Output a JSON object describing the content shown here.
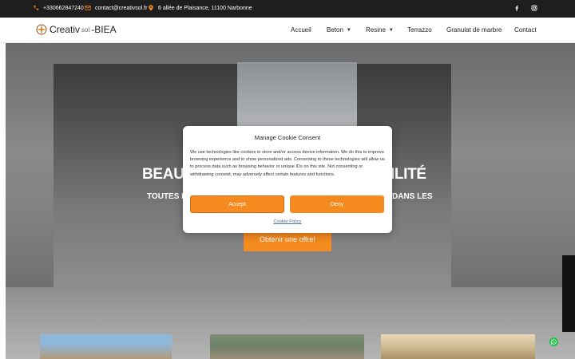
{
  "topbar": {
    "phone": "+330662847240",
    "email": "contact@creativsol.fr",
    "address": "6 allée de Plaisance, 11100 Narbonne",
    "social": [
      "facebook-icon",
      "instagram-icon"
    ]
  },
  "header": {
    "logo_text": "Creativ",
    "logo_sol": "sol",
    "logo_brand": "-BIEA",
    "nav": [
      "Accueil",
      "Beton",
      "Resine",
      "Terrazzo",
      "Granulat de marbre",
      "Contact"
    ]
  },
  "hero": {
    "title_left": "BEAUT",
    "title_right": "ABILITÉ",
    "subtitle_left": "TOUTES L",
    "subtitle_right": "DANS LES",
    "cta": "Obtenir une offre!"
  },
  "cookie": {
    "title": "Manage Cookie Consent",
    "body": "We use technologies like cookies to store and/or access device information. We do this to improve browsing experience and to show personalized ads. Consenting to these technologies will allow us to process data such as browsing behavior or unique IDs on this site. Not consenting or withdrawing consent, may adversely affect certain features and functions.",
    "accept": "Accept",
    "deny": "Deny",
    "policy_link": "Cookie Policy"
  },
  "colors": {
    "accent": "#f58a1f",
    "topbar": "#1e1e1e",
    "link": "#4a6da7",
    "whatsapp": "#27c14c"
  }
}
